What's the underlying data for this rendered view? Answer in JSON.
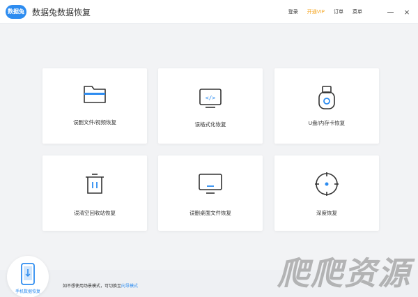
{
  "app": {
    "logo_text": "数据兔",
    "title": "数据兔数据恢复"
  },
  "top_menu": {
    "login": "登录",
    "vip": "开通VIP",
    "orders": "订单",
    "menu": "菜单"
  },
  "window_controls": {
    "close_glyph": "×"
  },
  "cards": [
    {
      "label": "误删文件/视频恢复",
      "icon": "folder-icon"
    },
    {
      "label": "误格式化恢复",
      "icon": "code-window-icon"
    },
    {
      "label": "U盘/内存卡恢复",
      "icon": "usb-drive-icon"
    },
    {
      "label": "误清空回收站恢复",
      "icon": "trash-icon"
    },
    {
      "label": "误删桌面文件恢复",
      "icon": "monitor-icon"
    },
    {
      "label": "深度恢复",
      "icon": "crosshair-icon"
    }
  ],
  "bottom": {
    "phone_label": "手机数据恢复",
    "hint_prefix": "如不想使用场景模式，可切换至",
    "hint_link": "向导模式"
  },
  "watermark": "爬爬资源",
  "colors": {
    "accent": "#2d8cf0",
    "vip": "#f5a623",
    "background": "#f2f3f5"
  }
}
